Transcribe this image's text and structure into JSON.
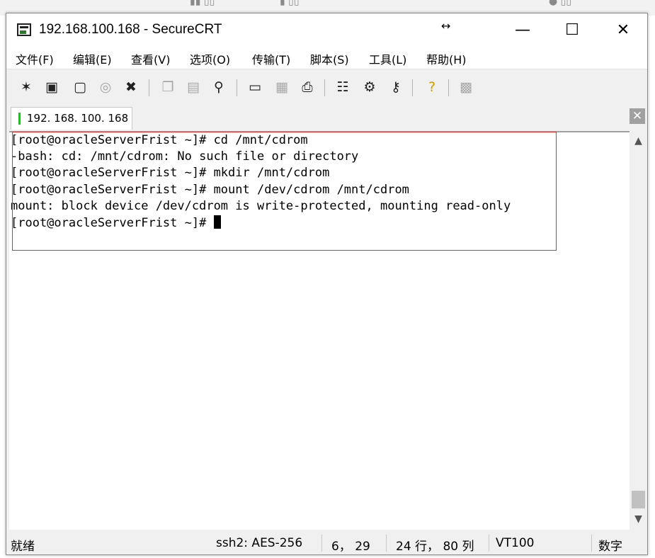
{
  "window": {
    "title": "192.168.100.168 - SecureCRT",
    "controls": {
      "minimize": "—",
      "maximize": "☐",
      "close": "✕"
    }
  },
  "menu": [
    "文件(F)",
    "编辑(E)",
    "查看(V)",
    "选项(O)",
    "传输(T)",
    "脚本(S)",
    "工具(L)",
    "帮助(H)"
  ],
  "toolbar": {
    "icons": [
      "quick-connect-icon",
      "connect-icon",
      "connect-in-tab-icon",
      "reconnect-icon",
      "disconnect-icon",
      "copy-icon",
      "paste-icon",
      "find-icon",
      "print-setup-icon",
      "print-selection-icon",
      "print-icon",
      "session-options-icon",
      "global-options-icon",
      "keymap-icon",
      "help-icon",
      "sftp-icon"
    ]
  },
  "tab": {
    "label": "192. 168. 100. 168",
    "status_color": "#2db52d"
  },
  "terminal": {
    "lines": [
      "[root@oracleServerFrist ~]# cd /mnt/cdrom",
      "-bash: cd: /mnt/cdrom: No such file or directory",
      "[root@oracleServerFrist ~]# mkdir /mnt/cdrom",
      "[root@oracleServerFrist ~]# mount /dev/cdrom /mnt/cdrom",
      "mount: block device /dev/cdrom is write-protected, mounting read-only",
      "[root@oracleServerFrist ~]# "
    ],
    "highlight_color": "#e03434"
  },
  "status": {
    "ready": "就绪",
    "protocol": "ssh2: AES-256",
    "position": "6，  29",
    "size": "24 行，  80 列",
    "emulation": "VT100",
    "numlock": "数字"
  }
}
